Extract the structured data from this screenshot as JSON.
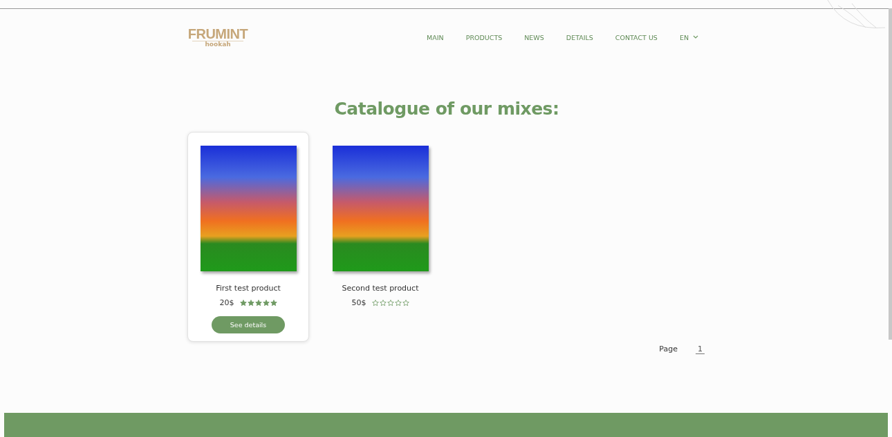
{
  "logo": {
    "brand": "FRUMINT",
    "sub": "hookah"
  },
  "nav": [
    {
      "label": "MAIN"
    },
    {
      "label": "PRODUCTS"
    },
    {
      "label": "NEWS"
    },
    {
      "label": "DETAILS"
    },
    {
      "label": "CONTACT US"
    }
  ],
  "language": "EN",
  "title": "Catalogue of our mixes:",
  "products": [
    {
      "name": "First test product",
      "price": "20$",
      "stars": 5,
      "selected": true,
      "button": "See details"
    },
    {
      "name": "Second test product",
      "price": "50$",
      "stars": 0,
      "selected": false
    }
  ],
  "pagination": {
    "label": "Page",
    "pages": [
      {
        "label": "1",
        "selected": true
      }
    ]
  }
}
